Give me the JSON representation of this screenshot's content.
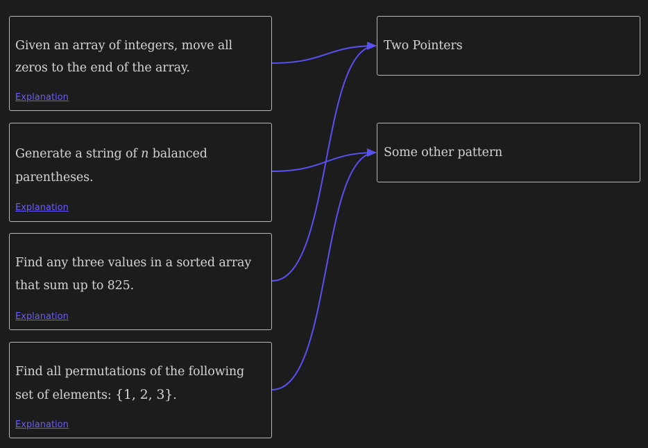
{
  "questions": [
    {
      "text": "Given an array of integers, move all zeros to the end of the array.",
      "link": "Explanation"
    },
    {
      "text_before": "Generate a string of ",
      "math_var": "n",
      "text_after": " balanced parentheses.",
      "link": "Explanation"
    },
    {
      "text_before": "Find any three values in a sorted array that sum up to ",
      "math": "825",
      "text_after": ".",
      "link": "Explanation"
    },
    {
      "text_before": "Find all permutations of the following set of elements: ",
      "math": "{1, 2, 3}",
      "text_after": ".",
      "link": "Explanation"
    }
  ],
  "answers": [
    {
      "label": "Two Pointers"
    },
    {
      "label": "Some other pattern"
    }
  ],
  "connections": [
    {
      "from": 0,
      "to": 0
    },
    {
      "from": 1,
      "to": 1
    },
    {
      "from": 2,
      "to": 0
    },
    {
      "from": 3,
      "to": 1
    }
  ],
  "colors": {
    "connector": "#5b50f0",
    "link": "#6a5cff",
    "border": "#b9b9bb",
    "background": "#1c1c1d",
    "text": "#d4d4d6"
  }
}
